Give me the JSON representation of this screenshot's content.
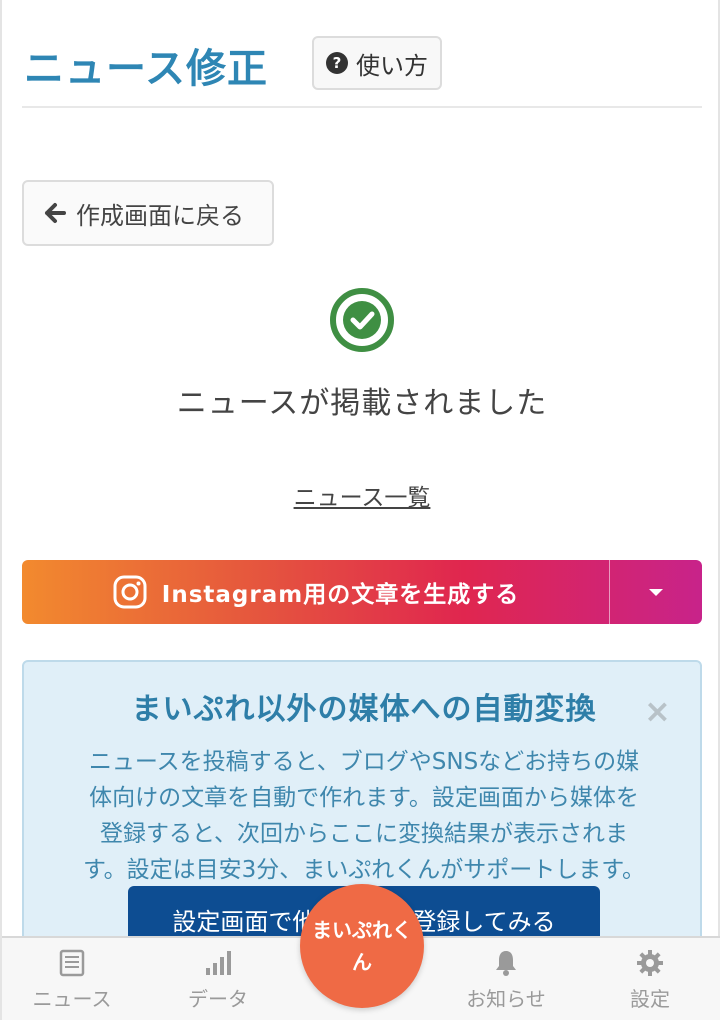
{
  "header": {
    "title": "ニュース修正",
    "help_label": "使い方"
  },
  "back_button": {
    "label": "作成画面に戻る"
  },
  "success": {
    "message": "ニュースが掲載されました"
  },
  "news_list_link": "ニュース一覧",
  "instagram": {
    "label": "Instagram用の文章を生成する"
  },
  "info_box": {
    "title": "まいぷれ以外の媒体への自動変換",
    "close_glyph": "×",
    "line1": "ニュースを投稿すると、ブログやSNSなどお持ちの媒",
    "line2": "体向けの文章を自動で作れます。設定画面から媒体を",
    "line3": "登録すると、次回からここに変換結果が表示されま",
    "line4": "す。設定は目安3分、まいぷれくんがサポートします。",
    "button_label": "設定画面で他の媒体を登録してみる"
  },
  "bottom_nav": {
    "items": [
      {
        "label": "ニュース",
        "icon": "news-icon"
      },
      {
        "label": "データ",
        "icon": "signal-bars-icon"
      },
      {
        "label": "お知らせ",
        "icon": "bell-icon"
      },
      {
        "label": "設定",
        "icon": "gear-icon"
      }
    ],
    "fab_label": "まいぷれくん"
  },
  "colors": {
    "title_blue": "#2e86b4",
    "check_green": "#3f8f43",
    "info_bg": "#e0eff8",
    "info_button": "#0d4d92",
    "fab_orange": "#ef6a45"
  }
}
